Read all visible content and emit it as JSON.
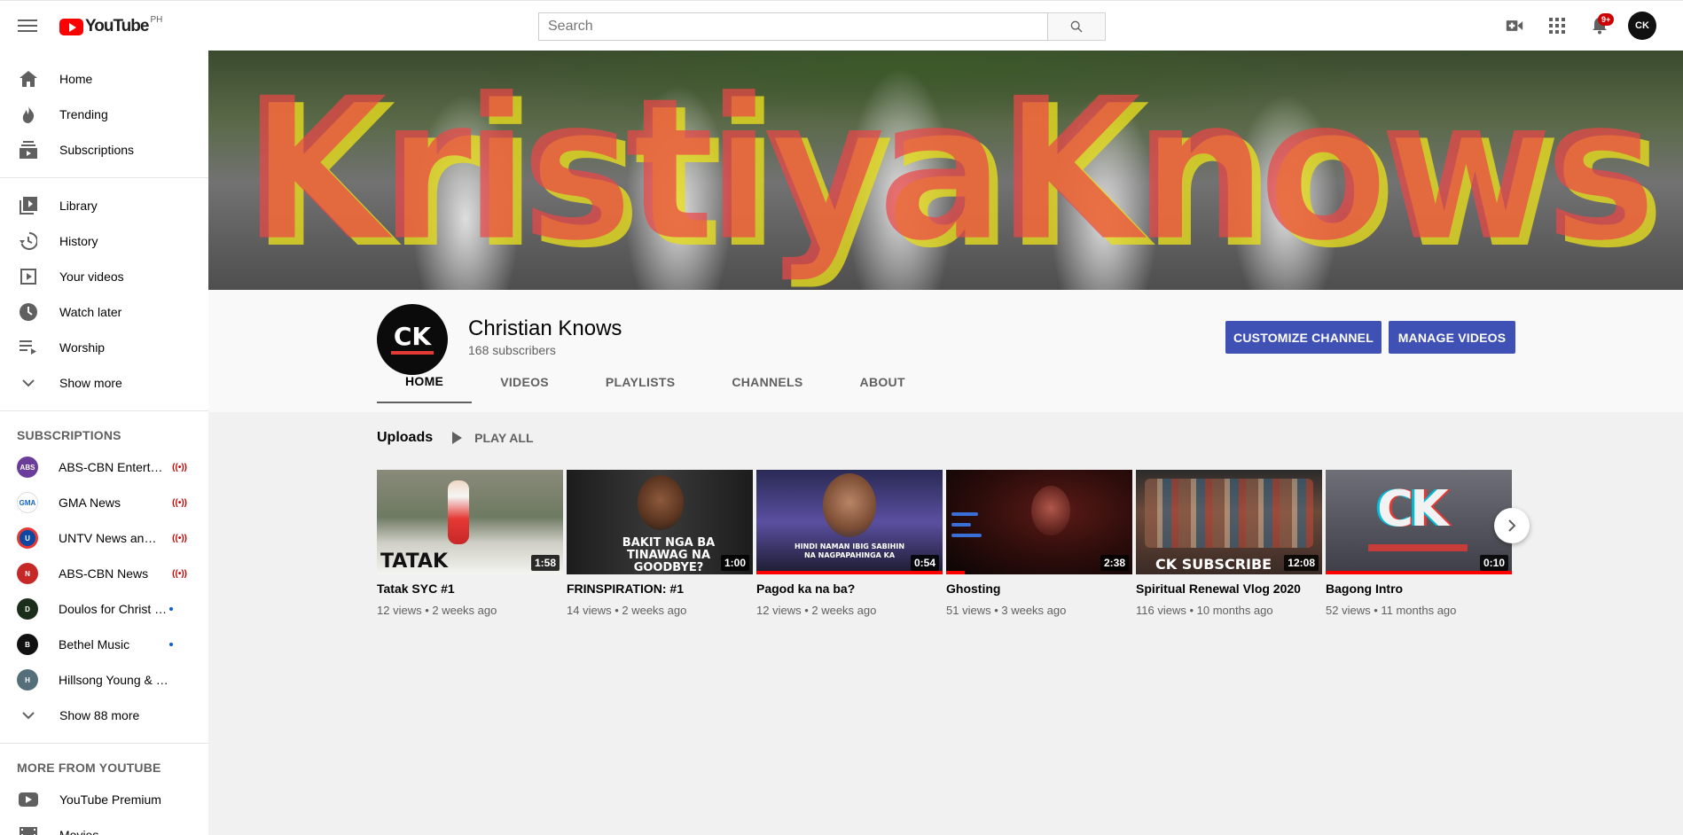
{
  "header": {
    "logo_text": "YouTube",
    "country": "PH",
    "search_placeholder": "Search",
    "notifications": "9+",
    "avatar_text": "CK"
  },
  "sidebar": {
    "main": [
      {
        "label": "Home",
        "icon": "home-icon"
      },
      {
        "label": "Trending",
        "icon": "trending-icon"
      },
      {
        "label": "Subscriptions",
        "icon": "subscriptions-icon"
      }
    ],
    "library": [
      {
        "label": "Library",
        "icon": "library-icon"
      },
      {
        "label": "History",
        "icon": "history-icon"
      },
      {
        "label": "Your videos",
        "icon": "your-videos-icon"
      },
      {
        "label": "Watch later",
        "icon": "watch-later-icon"
      },
      {
        "label": "Worship",
        "icon": "playlist-icon"
      },
      {
        "label": "Show more",
        "icon": "chevron-down-icon"
      }
    ],
    "subscriptions_title": "SUBSCRIPTIONS",
    "subscriptions": [
      {
        "label": "ABS-CBN Entertainment",
        "status": "live",
        "color": "#6a3d9a"
      },
      {
        "label": "GMA News",
        "status": "live",
        "color": "#1565c0"
      },
      {
        "label": "UNTV News and Rescue",
        "status": "live",
        "color": "#0d47a1"
      },
      {
        "label": "ABS-CBN News",
        "status": "live",
        "color": "#c62828"
      },
      {
        "label": "Doulos for Christ Band",
        "status": "new",
        "color": "#1b5e20"
      },
      {
        "label": "Bethel Music",
        "status": "new",
        "color": "#111111"
      },
      {
        "label": "Hillsong Young & Free",
        "status": "",
        "color": "#37474f"
      }
    ],
    "show_more_subs": "Show 88 more",
    "more_title": "MORE FROM YOUTUBE",
    "more": [
      {
        "label": "YouTube Premium",
        "icon": "youtube-premium-icon"
      },
      {
        "label": "Movies",
        "icon": "movies-icon"
      }
    ]
  },
  "channel": {
    "banner_text": "KristiyaKnows",
    "avatar_text": "CK",
    "name": "Christian Knows",
    "subscribers": "168 subscribers",
    "customize_label": "CUSTOMIZE CHANNEL",
    "manage_label": "MANAGE VIDEOS",
    "tabs": [
      "HOME",
      "VIDEOS",
      "PLAYLISTS",
      "CHANNELS",
      "ABOUT"
    ]
  },
  "uploads": {
    "title": "Uploads",
    "play_all": "PLAY ALL",
    "videos": [
      {
        "title": "Tatak SYC #1",
        "meta": "12 views • 2 weeks ago",
        "duration": "1:58",
        "thumb_text": "TATAK",
        "progress": 0
      },
      {
        "title": "FRINSPIRATION: #1",
        "meta": "14 views • 2 weeks ago",
        "duration": "1:00",
        "thumb_text": "BAKIT NGA BA TINAWAG NA GOODBYE?",
        "progress": 0
      },
      {
        "title": "Pagod ka na ba?",
        "meta": "12 views • 2 weeks ago",
        "duration": "0:54",
        "thumb_text": "HINDI NAMAN IBIG SABIHIN NA NAGPAPAHINGA KA",
        "progress": 1.0
      },
      {
        "title": "Ghosting",
        "meta": "51 views • 3 weeks ago",
        "duration": "2:38",
        "thumb_text": "",
        "progress": 0.1
      },
      {
        "title": "Spiritual Renewal Vlog 2020",
        "meta": "116 views • 10 months ago",
        "duration": "12:08",
        "thumb_text": "CK SUBSCRIBE",
        "progress": 0
      },
      {
        "title": "Bagong Intro",
        "meta": "52 views • 11 months ago",
        "duration": "0:10",
        "thumb_text": "CK",
        "progress": 1.0
      }
    ]
  }
}
